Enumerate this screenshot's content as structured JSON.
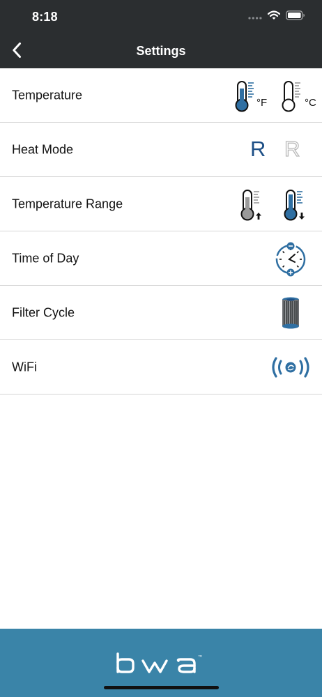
{
  "status_bar": {
    "time": "8:18",
    "icons": [
      "signal-dots-icon",
      "wifi-icon",
      "battery-icon"
    ]
  },
  "nav": {
    "back_icon": "chevron-left-icon",
    "title": "Settings"
  },
  "settings": {
    "items": [
      {
        "label": "Temperature",
        "icons": [
          "thermometer-fahrenheit-icon",
          "thermometer-celsius-icon"
        ],
        "fahrenheit_unit": "°F",
        "celsius_unit": "°C",
        "selected": "°F"
      },
      {
        "label": "Heat Mode",
        "icons": [
          "heat-mode-ready-icon",
          "heat-mode-rest-icon"
        ],
        "active_mode": "R",
        "inactive_mode": "R"
      },
      {
        "label": "Temperature Range",
        "icons": [
          "thermometer-high-range-icon",
          "thermometer-low-range-icon"
        ],
        "selected": "low"
      },
      {
        "label": "Time of Day",
        "icons": [
          "clock-adjust-icon"
        ]
      },
      {
        "label": "Filter Cycle",
        "icons": [
          "filter-cartridge-icon"
        ]
      },
      {
        "label": "WiFi",
        "icons": [
          "wifi-signal-icon"
        ]
      }
    ]
  },
  "footer": {
    "brand": "bwa",
    "brand_mark": "™"
  },
  "colors": {
    "header_bg": "#2b2e30",
    "footer_bg": "#3a84a8",
    "accent_blue": "#1d4f86",
    "icon_blue": "#2f6fa2",
    "divider": "#d6d6d6"
  }
}
